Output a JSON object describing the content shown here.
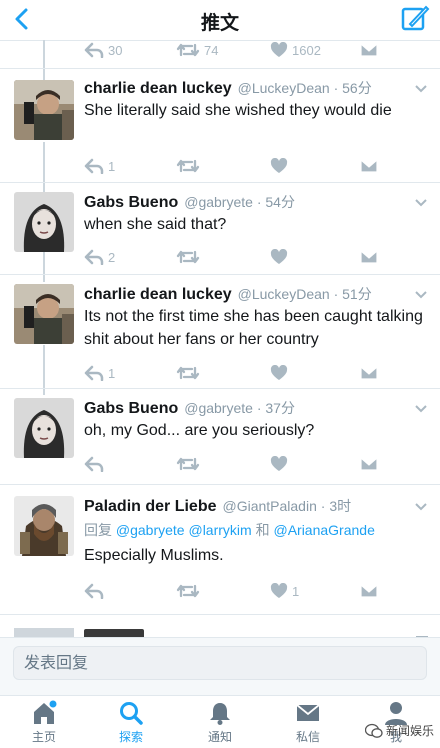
{
  "nav": {
    "title": "推文"
  },
  "top_actions": {
    "retweets": "30",
    "likes": "74",
    "like_count": "1602"
  },
  "tweets": [
    {
      "name": "charlie dean luckey",
      "handle": "@LuckeyDean",
      "time": "· 56分",
      "text": "She literally said she wished they would die",
      "reply_count": "1",
      "likes": ""
    },
    {
      "name": "Gabs Bueno",
      "handle": "@gabryete",
      "time": "· 54分",
      "text": "when she said that?",
      "reply_count": "2",
      "likes": ""
    },
    {
      "name": "charlie dean luckey",
      "handle": "@LuckeyDean",
      "time": "· 51分",
      "text": "Its not the first time she has been caught talking shit about her fans or her country",
      "reply_count": "1",
      "likes": ""
    },
    {
      "name": "Gabs Bueno",
      "handle": "@gabryete",
      "time": "· 37分",
      "text": "oh, my God... are you seriously?",
      "reply_count": "",
      "likes": ""
    },
    {
      "name": "Paladin der Liebe",
      "handle": "@GiantPaladin",
      "time": "· 3时",
      "reply_prefix": "回复",
      "mention1": "@gabryete",
      "mention2": "@larrykim",
      "conj": "和",
      "mention3": "@ArianaGrande",
      "text": "Especially Muslims.",
      "reply_count": "",
      "likes": "1"
    }
  ],
  "reply_box": {
    "placeholder": "发表回复"
  },
  "tabs": [
    {
      "label": "主页",
      "icon": "home-icon"
    },
    {
      "label": "探索",
      "icon": "search-icon"
    },
    {
      "label": "通知",
      "icon": "bell-icon"
    },
    {
      "label": "私信",
      "icon": "mail-icon"
    },
    {
      "label": "我",
      "icon": "profile-icon"
    }
  ],
  "watermark": {
    "text": "新闻娱乐"
  },
  "colors": {
    "accent": "#1da1f2",
    "muted": "#aab8c2",
    "text": "#14171a",
    "handle": "#8899a6"
  }
}
